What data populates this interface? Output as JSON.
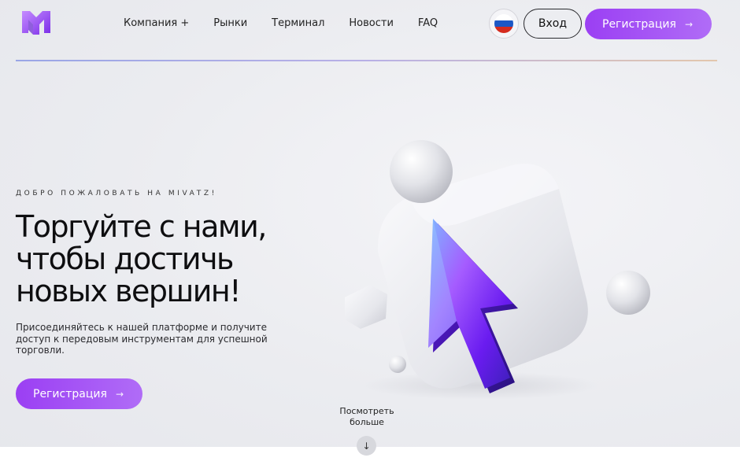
{
  "header": {
    "nav": [
      "Компания +",
      "Рынки",
      "Терминал",
      "Новости",
      "FAQ"
    ],
    "login_label": "Вход",
    "register_label": "Регистрация",
    "arrow_glyph": "→",
    "flag": "russia-flag-icon"
  },
  "hero": {
    "welcome": "ДОБРО ПОЖАЛОВАТЬ НА MIVATZ!",
    "title_lines": [
      "Торгуйте с нами,",
      "чтобы достичь",
      "новых вершин!"
    ],
    "description": "Присоединяйтесь к нашей платформе и получите доступ к передовым инструментам для успешной торговли.",
    "register_label": "Регистрация",
    "arrow_glyph": "→"
  },
  "see_more": {
    "label_lines": [
      "Посмотреть",
      "больше"
    ],
    "arrow_glyph": "↓"
  },
  "colors": {
    "accent": "#9b3ff3",
    "accent_light": "#b06cf7",
    "background": "#ecedf1",
    "text": "#0e0e10"
  }
}
